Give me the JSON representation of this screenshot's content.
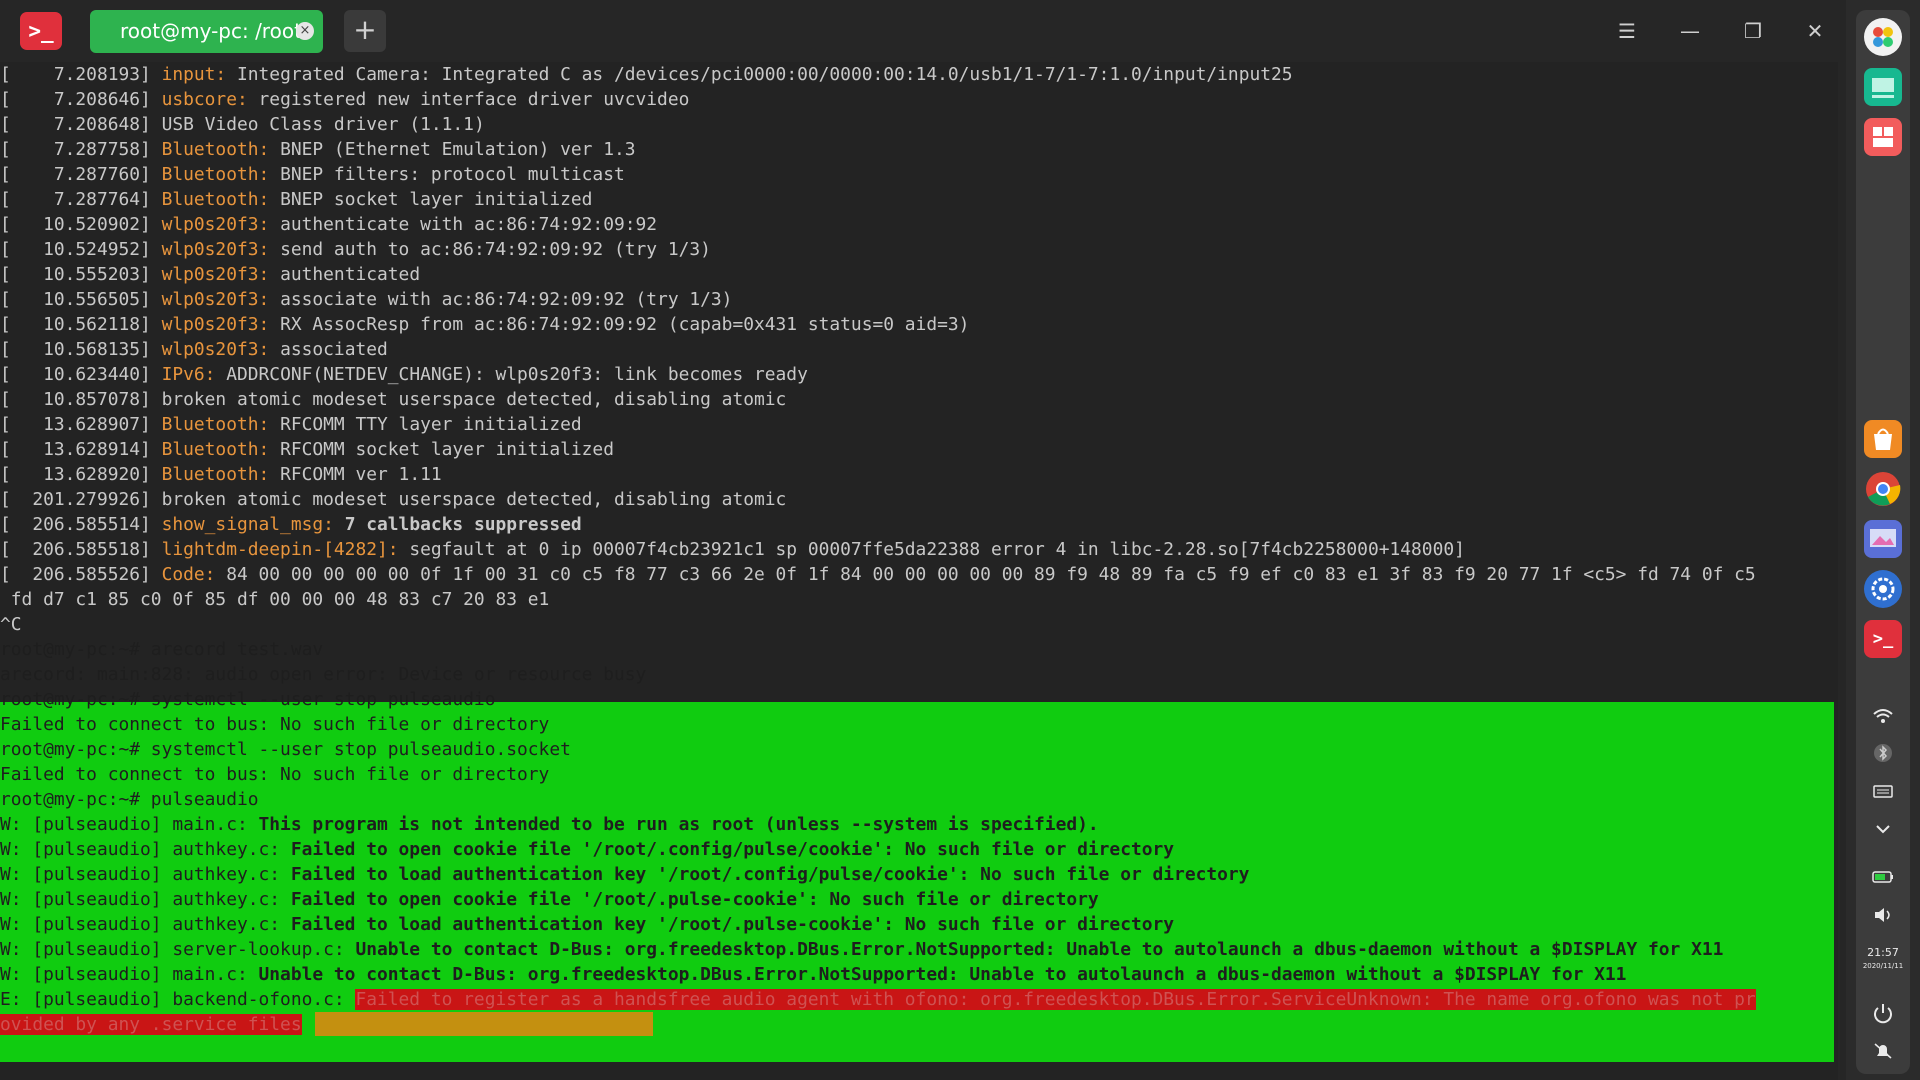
{
  "app": {
    "title": "Terminal"
  },
  "tab": {
    "title": "root@my-pc: /root",
    "close_glyph": "×"
  },
  "new_tab": {
    "label": "+"
  },
  "window_buttons": {
    "menu": "☰",
    "minimize": "—",
    "maximize": "❐",
    "close": "✕"
  },
  "kernel_log": [
    {
      "ts": "[    7.208193] ",
      "src": "input:",
      "msg": " Integrated Camera: Integrated C as /devices/pci0000:00/0000:00:14.0/usb1/1-7/1-7:1.0/input/input25"
    },
    {
      "ts": "[    7.208646] ",
      "src": "usbcore:",
      "msg": " registered new interface driver uvcvideo"
    },
    {
      "ts": "[    7.208648] ",
      "src": "",
      "msg": "USB Video Class driver (1.1.1)"
    },
    {
      "ts": "[    7.287758] ",
      "src": "Bluetooth:",
      "msg": " BNEP (Ethernet Emulation) ver 1.3"
    },
    {
      "ts": "[    7.287760] ",
      "src": "Bluetooth:",
      "msg": " BNEP filters: protocol multicast"
    },
    {
      "ts": "[    7.287764] ",
      "src": "Bluetooth:",
      "msg": " BNEP socket layer initialized"
    },
    {
      "ts": "[   10.520902] ",
      "src": "wlp0s20f3:",
      "msg": " authenticate with ac:86:74:92:09:92"
    },
    {
      "ts": "[   10.524952] ",
      "src": "wlp0s20f3:",
      "msg": " send auth to ac:86:74:92:09:92 (try 1/3)"
    },
    {
      "ts": "[   10.555203] ",
      "src": "wlp0s20f3:",
      "msg": " authenticated"
    },
    {
      "ts": "[   10.556505] ",
      "src": "wlp0s20f3:",
      "msg": " associate with ac:86:74:92:09:92 (try 1/3)"
    },
    {
      "ts": "[   10.562118] ",
      "src": "wlp0s20f3:",
      "msg": " RX AssocResp from ac:86:74:92:09:92 (capab=0x431 status=0 aid=3)"
    },
    {
      "ts": "[   10.568135] ",
      "src": "wlp0s20f3:",
      "msg": " associated"
    },
    {
      "ts": "[   10.623440] ",
      "src": "IPv6:",
      "msg": " ADDRCONF(NETDEV_CHANGE): wlp0s20f3: link becomes ready"
    },
    {
      "ts": "[   10.857078] ",
      "src": "",
      "msg": "broken atomic modeset userspace detected, disabling atomic"
    },
    {
      "ts": "[   13.628907] ",
      "src": "Bluetooth:",
      "msg": " RFCOMM TTY layer initialized"
    },
    {
      "ts": "[   13.628914] ",
      "src": "Bluetooth:",
      "msg": " RFCOMM socket layer initialized"
    },
    {
      "ts": "[   13.628920] ",
      "src": "Bluetooth:",
      "msg": " RFCOMM ver 1.11"
    },
    {
      "ts": "[  201.279926] ",
      "src": "",
      "msg": "broken atomic modeset userspace detected, disabling atomic"
    },
    {
      "ts": "[  206.585514] ",
      "src": "show_signal_msg:",
      "msg": " 7 callbacks suppressed"
    },
    {
      "ts": "[  206.585518] ",
      "src": "lightdm-deepin-[4282]:",
      "msg": " segfault at 0 ip 00007f4cb23921c1 sp 00007ffe5da22388 error 4 in libc-2.28.so[7f4cb2258000+148000]"
    },
    {
      "ts": "[  206.585526] ",
      "src": "Code:",
      "msg": " 84 00 00 00 00 00 0f 1f 00 31 c0 c5 f8 77 c3 66 2e 0f 1f 84 00 00 00 00 00 89 f9 48 89 fa c5 f9 ef c0 83 e1 3f 83 f9 20 77 1f <c5> fd 74 0f c5"
    }
  ],
  "code_continuation": " fd d7 c1 85 c0 0f 85 df 00 00 00 48 83 c7 20 83 e1",
  "interrupt": "^C",
  "session": {
    "l1": "root@my-pc:~# arecord test.wav",
    "l2": "arecord: main:828: audio open error: Device or resource busy",
    "l3": "root@my-pc:~# systemctl --user stop pulseaudio",
    "l4": "Failed to connect to bus: No such file or directory",
    "l5": "root@my-pc:~# systemctl --user stop pulseaudio.socket",
    "l6": "Failed to connect to bus: No such file or directory",
    "l7": "root@my-pc:~# pulseaudio",
    "w1_pre": "W: [pulseaudio] main.c: ",
    "w1_msg": "This program is not intended to be run as root (unless --system is specified).",
    "w2_pre": "W: [pulseaudio] authkey.c: ",
    "w2_msg": "Failed to open cookie file '/root/.config/pulse/cookie': No such file or directory",
    "w3_pre": "W: [pulseaudio] authkey.c: ",
    "w3_msg": "Failed to load authentication key '/root/.config/pulse/cookie': No such file or directory",
    "w4_pre": "W: [pulseaudio] authkey.c: ",
    "w4_msg": "Failed to open cookie file '/root/.pulse-cookie': No such file or directory",
    "w5_pre": "W: [pulseaudio] authkey.c: ",
    "w5_msg": "Failed to load authentication key '/root/.pulse-cookie': No such file or directory",
    "w6_pre": "W: [pulseaudio] server-lookup.c: ",
    "w6_msg": "Unable to contact D-Bus: org.freedesktop.DBus.Error.NotSupported: Unable to autolaunch a dbus-daemon without a $DISPLAY for X11",
    "w7_pre": "W: [pulseaudio] main.c: ",
    "w7_msg": "Unable to contact D-Bus: org.freedesktop.DBus.Error.NotSupported: Unable to autolaunch a dbus-daemon without a $DISPLAY for X11",
    "e1_pre": "E: [pulseaudio] backend-ofono.c: ",
    "e1_msg": "Failed to register as a handsfree audio agent with ofono: org.freedesktop.DBus.Error.ServiceUnknown: The name org.ofono was not pr",
    "e1_cont": "ovided by any .service files"
  },
  "dock": {
    "apps": [
      "launcher-icon",
      "multitasking-icon",
      "app-store-icon",
      "chrome-icon",
      "image-viewer-icon",
      "settings-icon",
      "terminal-icon"
    ],
    "tray": [
      "wifi-icon",
      "bluetooth-icon",
      "keyboard-icon",
      "chevron-down-icon",
      "battery-icon",
      "volume-icon"
    ],
    "time": "21:57",
    "date": "2020/11/11"
  },
  "colors": {
    "accent_green": "#10cc10",
    "error_red": "#c91515",
    "source_orange": "#e8953d",
    "tab_green": "#2eb34f"
  }
}
